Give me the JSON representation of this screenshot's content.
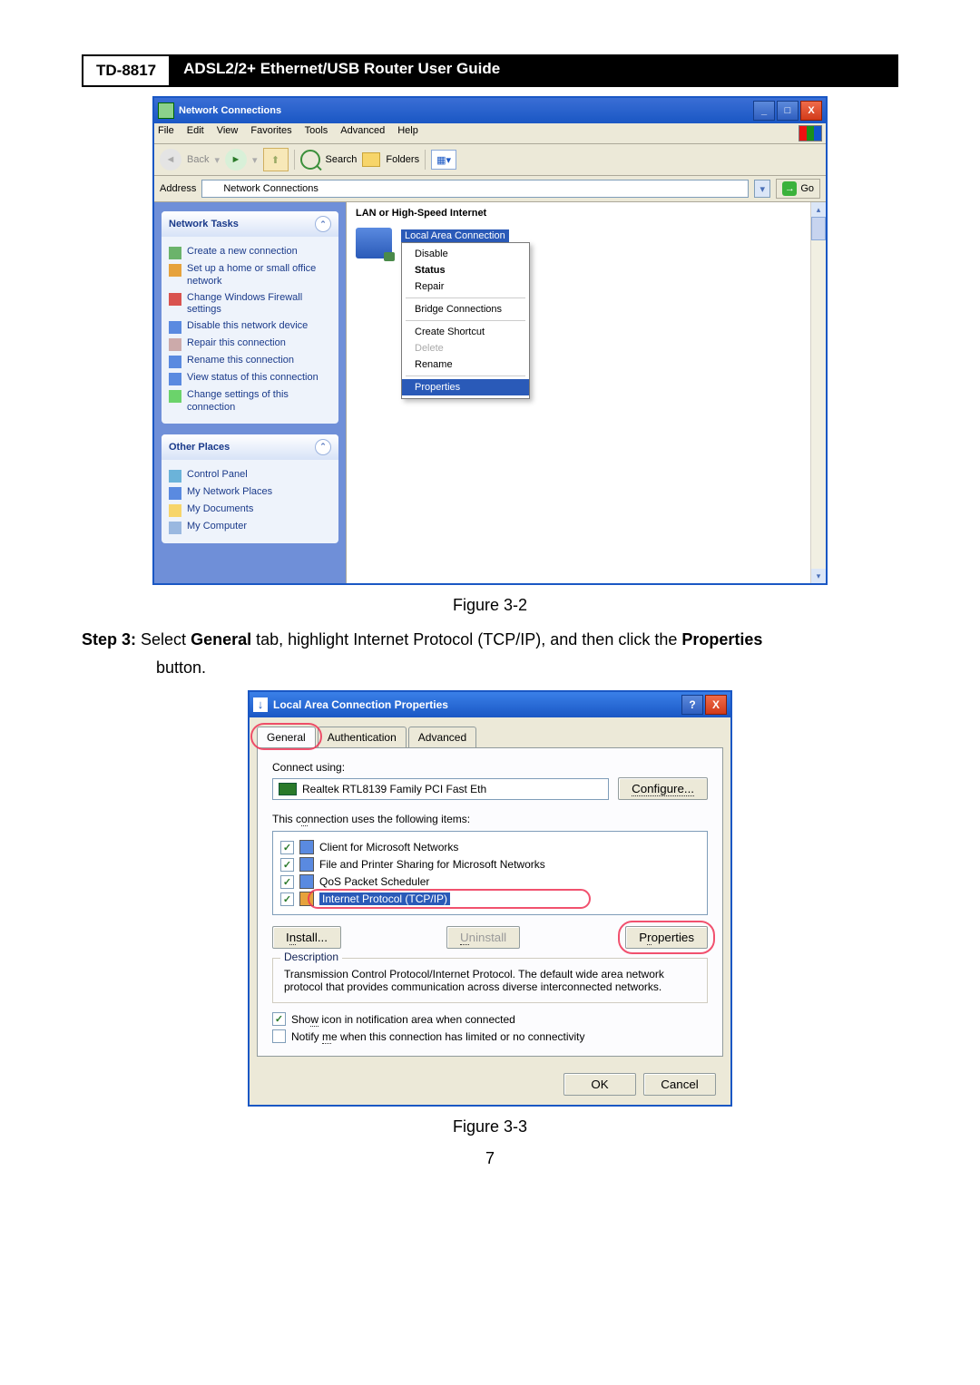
{
  "header": {
    "model": "TD-8817",
    "title": "ADSL2/2+ Ethernet/USB Router User Guide"
  },
  "figure1": {
    "title": "Network Connections",
    "menu": [
      "File",
      "Edit",
      "View",
      "Favorites",
      "Tools",
      "Advanced",
      "Help"
    ],
    "toolbar": {
      "back": "Back",
      "search": "Search",
      "folders": "Folders"
    },
    "address": {
      "label": "Address",
      "value": "Network Connections",
      "go": "Go"
    },
    "panel1": {
      "title": "Network Tasks",
      "items": [
        "Create a new connection",
        "Set up a home or small office network",
        "Change Windows Firewall settings",
        "Disable this network device",
        "Repair this connection",
        "Rename this connection",
        "View status of this connection",
        "Change settings of this connection"
      ]
    },
    "panel2": {
      "title": "Other Places",
      "items": [
        "Control Panel",
        "My Network Places",
        "My Documents",
        "My Computer"
      ]
    },
    "category": "LAN or High-Speed Internet",
    "lac": "Local Area Connection",
    "ctx": [
      "Disable",
      "Status",
      "Repair",
      "Bridge Connections",
      "Create Shortcut",
      "Delete",
      "Rename",
      "Properties"
    ],
    "caption": "Figure 3-2"
  },
  "step": {
    "label": "Step 3:",
    "text1": "Select ",
    "b1": "General",
    "text2": " tab, highlight Internet Protocol (TCP/IP), and then click the ",
    "b2": "Properties",
    "text3": "button."
  },
  "figure2": {
    "title": "Local Area Connection Properties",
    "tabs": [
      "General",
      "Authentication",
      "Advanced"
    ],
    "connect": "Connect using:",
    "adapter": "Realtek RTL8139 Family PCI Fast Eth",
    "configure": "Configure...",
    "uses": "This connection uses the following items:",
    "items": [
      "Client for Microsoft Networks",
      "File and Printer Sharing for Microsoft Networks",
      "QoS Packet Scheduler",
      "Internet Protocol (TCP/IP)"
    ],
    "install": "Install...",
    "uninstall": "Uninstall",
    "properties": "Properties",
    "desc_title": "Description",
    "desc": "Transmission Control Protocol/Internet Protocol. The default wide area network protocol that provides communication across diverse interconnected networks.",
    "show": "Show icon in notification area when connected",
    "notify": "Notify me when this connection has limited or no connectivity",
    "ok": "OK",
    "cancel": "Cancel",
    "caption": "Figure 3-3"
  },
  "pagenum": "7"
}
